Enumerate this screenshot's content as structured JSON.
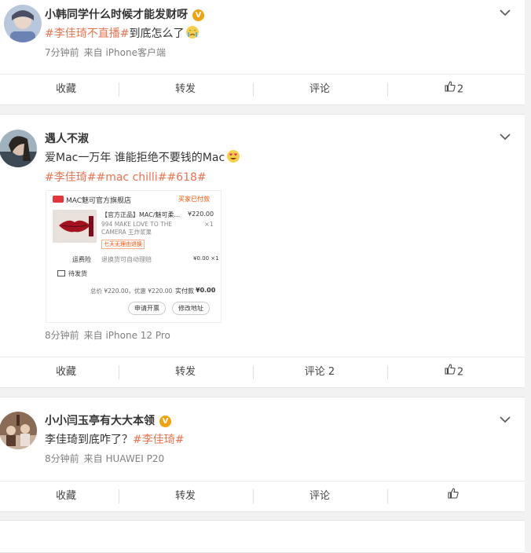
{
  "posts": [
    {
      "username": "小韩同学什么时候才能发财呀",
      "verified": true,
      "topic": "#李佳琦不直播#",
      "text": "到底怎么了",
      "emoji": "crying-face-emoji",
      "time": "7分钟前",
      "source": "来自 iPhone客户端",
      "actions": {
        "fav": "收藏",
        "repost": "转发",
        "comment": "评论",
        "likes": "2"
      }
    },
    {
      "username": "遇人不淑",
      "verified": false,
      "text": "爱Mac一万年 谁能拒绝不要钱的Mac",
      "emoji": "heart-eyes-emoji",
      "topics": [
        "#李佳琦#",
        "#mac chilli#",
        "#618#"
      ],
      "order": {
        "shop": "MAC魅可官方旗舰店",
        "status": "买家已付款",
        "product_title": "【官方正品】MAC/魅可柔...",
        "price": "¥220.00",
        "variant": "994 MAKE LOVE TO THE CAMERA 王炸浆果",
        "qty": "×1",
        "tag": "七天无理由退换",
        "shipping_label": "运费险",
        "shipping_note": "退换货可自动理赔",
        "shipping_price": "¥0.00 ×1",
        "pending": "待发货",
        "total_line": "总价 ¥220.00，优惠 ¥220.00",
        "paid_label": "实付款",
        "paid_value": "¥0.00",
        "btn_invoice": "申请开票",
        "btn_address": "修改地址"
      },
      "time": "8分钟前",
      "source": "来自 iPhone 12 Pro",
      "actions": {
        "fav": "收藏",
        "repost": "转发",
        "comment": "评论 2",
        "likes": "2"
      }
    },
    {
      "username": "小小闫玉亭有大大本领",
      "verified": true,
      "text": "李佳琦到底咋了？",
      "topic": "#李佳琦#",
      "time": "8分钟前",
      "source": "来自 HUAWEI P20",
      "actions": {
        "fav": "收藏",
        "repost": "转发",
        "comment": "评论",
        "likes": ""
      }
    }
  ],
  "colors": {
    "topic": "#eb7350",
    "verified": "#f2a20c",
    "meta": "#808080"
  }
}
